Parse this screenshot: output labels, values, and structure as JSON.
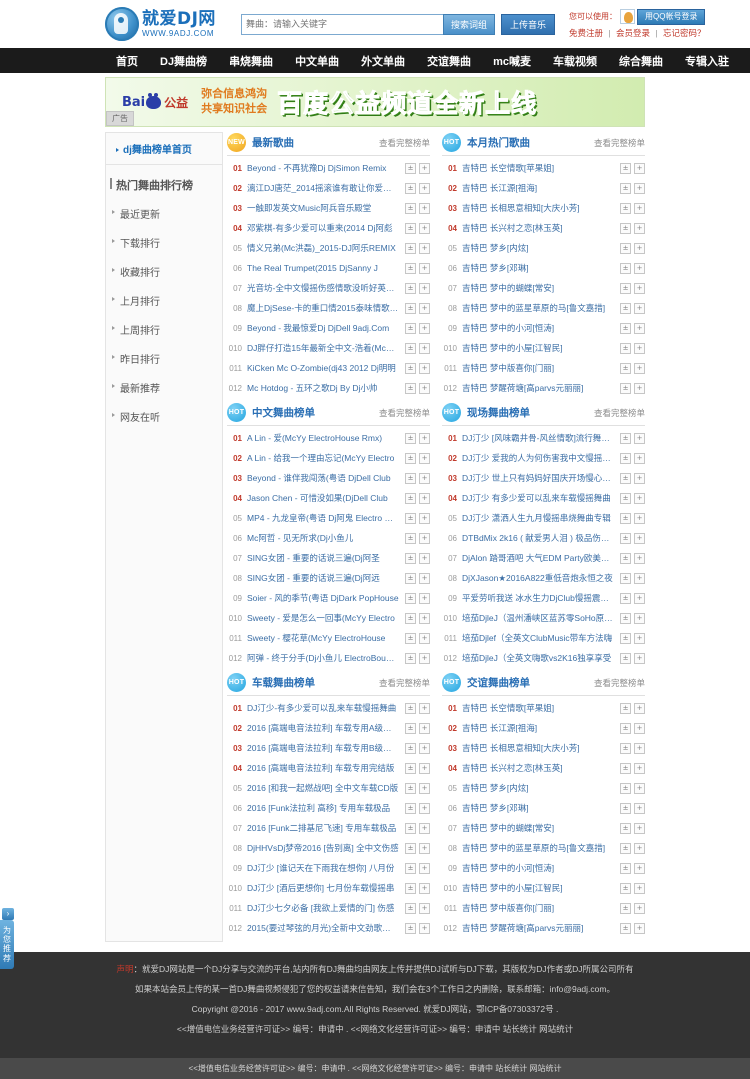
{
  "site": {
    "logo_name": "就爱DJ网",
    "logo_url": "WWW.9ADJ.COM"
  },
  "search": {
    "placeholder": "舞曲：请输入关键字",
    "value": "",
    "search_label": "搜索词组",
    "upload_label": "上传音乐"
  },
  "user": {
    "hint": "您可以使用：",
    "qq_login_label": "用QQ帐号登录",
    "register": "免费注册",
    "login": "会员登录",
    "forgot": "忘记密码？",
    "sep": "|"
  },
  "nav": [
    {
      "label": "首页"
    },
    {
      "label": "DJ舞曲榜"
    },
    {
      "label": "串烧舞曲"
    },
    {
      "label": "中文单曲"
    },
    {
      "label": "外文单曲"
    },
    {
      "label": "交谊舞曲"
    },
    {
      "label": "mc喊麦"
    },
    {
      "label": "车载视频"
    },
    {
      "label": "综合舞曲"
    },
    {
      "label": "专辑入驻"
    }
  ],
  "banner": {
    "brand_bai": "Bai",
    "brand_gongyi": "公益",
    "slogan_line1": "弥合信息鸿沟",
    "slogan_line2": "共享知识社会",
    "headline": "百度公益频道全新上线",
    "ad_tag": "广告"
  },
  "sidebar": {
    "home_label": "dj舞曲榜单首页",
    "section_title": "热门舞曲排行榜",
    "items": [
      {
        "label": "最近更新"
      },
      {
        "label": "下载排行"
      },
      {
        "label": "收藏排行"
      },
      {
        "label": "上月排行"
      },
      {
        "label": "上周排行"
      },
      {
        "label": "昨日排行"
      },
      {
        "label": "最新推荐"
      },
      {
        "label": "网友在听"
      }
    ]
  },
  "common": {
    "more_label": "查看完整榜单",
    "download_icon": "±",
    "add_icon": "+"
  },
  "panels": [
    {
      "badge": "NEW",
      "badge_type": "new",
      "title": "最新歌曲",
      "songs": [
        {
          "num": "01",
          "name": "Beyond - 不再犹豫Dj DjSimon Remix"
        },
        {
          "num": "02",
          "name": "漓江DJ唐茫_2014摇滚谁有敢让你爱不经手"
        },
        {
          "num": "03",
          "name": "一触即发英文Music阿兵音乐殿堂"
        },
        {
          "num": "04",
          "name": "邓紫棋-有多少爱可以重来(2014 Dj阿彪"
        },
        {
          "num": "05",
          "name": "情义兄弟(Mc洪磊)_2015-DJ阿乐REMIX"
        },
        {
          "num": "06",
          "name": "The Real Trumpet(2015 DjSanny J"
        },
        {
          "num": "07",
          "name": "光音坊-全中文慢摇伤感情歌没听好英电音"
        },
        {
          "num": "08",
          "name": "魔上DjSese-卡的重口情2015泰味情歌一路"
        },
        {
          "num": "09",
          "name": "Beyond - 我最惊爱Dj DjDell 9adj.Com"
        },
        {
          "num": "010",
          "name": "DJ胖仔打造15年最新全中文-浩着(Mc洪磊)"
        },
        {
          "num": "011",
          "name": "KiCken Mc O-Zombie(dj43 2012 Dj明明"
        },
        {
          "num": "012",
          "name": "Mc Hotdog - 五环之歌Dj By Dj小帅"
        }
      ]
    },
    {
      "badge": "HOT",
      "badge_type": "hot",
      "title": "本月热门歌曲",
      "songs": [
        {
          "num": "01",
          "name": "吉特巴 长空情歌[苹果姐]"
        },
        {
          "num": "02",
          "name": "吉特巴 长江源[祖海]"
        },
        {
          "num": "03",
          "name": "吉特巴 长相思意相知[大庆小芳]"
        },
        {
          "num": "04",
          "name": "吉特巴 长兴村之恋[林玉英]"
        },
        {
          "num": "05",
          "name": "吉特巴 梦乡[内炫]"
        },
        {
          "num": "06",
          "name": "吉特巴 梦乡[邓琳]"
        },
        {
          "num": "07",
          "name": "吉特巴 梦中的蝴蝶[常安]"
        },
        {
          "num": "08",
          "name": "吉特巴 梦中的蓝星草原的马[鲁文嘉措]"
        },
        {
          "num": "09",
          "name": "吉特巴 梦中的小河[恒涛]"
        },
        {
          "num": "010",
          "name": "吉特巴 梦中的小屋[江智民]"
        },
        {
          "num": "011",
          "name": "吉特巴 梦中版喜你[门丽]"
        },
        {
          "num": "012",
          "name": "吉特巴 梦醒荷塘[高parvs元丽丽]"
        }
      ]
    },
    {
      "badge": "HOT",
      "badge_type": "hot",
      "title": "中文舞曲榜单",
      "songs": [
        {
          "num": "01",
          "name": "A Lin - 爱(McYy ElectroHouse Rmx)"
        },
        {
          "num": "02",
          "name": "A Lin - 给我一个理由忘记(McYy Electro"
        },
        {
          "num": "03",
          "name": "Beyond - 谁伴我闯荡(粤语 DjDell Club"
        },
        {
          "num": "04",
          "name": "Jason Chen - 可惜没如果(DjDell Club"
        },
        {
          "num": "05",
          "name": "MP4 - 九龙皇帝(粤语 Dj阿鬼 Electro Rmx)"
        },
        {
          "num": "06",
          "name": "Mc阿哲 - 见无所求(Dj小鱼儿"
        },
        {
          "num": "07",
          "name": "SING女团 - 重要的话说三遍(Dj阿圣"
        },
        {
          "num": "08",
          "name": "SING女团 - 重要的话说三遍(Dj阿远"
        },
        {
          "num": "09",
          "name": "Soier - 风的季节(粤语 DjDark PopHouse"
        },
        {
          "num": "010",
          "name": "Sweety - 爱是怎么一回事(McYy Electro"
        },
        {
          "num": "011",
          "name": "Sweety - 樱花草(McYy ElectroHouse"
        },
        {
          "num": "012",
          "name": "阿弹 - 终于分手(Dj小鱼儿 ElectroBounce"
        }
      ]
    },
    {
      "badge": "HOT",
      "badge_type": "hot",
      "title": "现场舞曲榜单",
      "songs": [
        {
          "num": "01",
          "name": "DJ汀少 [风味霸井骨-风丝情歌]流行舞曲慢"
        },
        {
          "num": "02",
          "name": "DJ汀少 爱我的人为何伤害我中文慢摇串烧"
        },
        {
          "num": "03",
          "name": "DJ汀少 世上只有妈妈好国庆开场慢心串烧"
        },
        {
          "num": "04",
          "name": "DJ汀少 有多少爱可以乱来车载慢摇舞曲"
        },
        {
          "num": "05",
          "name": "DJ汀少 潇洒人生九月慢摇串烧舞曲专辑"
        },
        {
          "num": "06",
          "name": "DTBdMix 2k16 ( 献爱男人泪 ) 极品伤感连"
        },
        {
          "num": "07",
          "name": "DjAlon 踏哥酒吧 大气EDM Party欧美电音"
        },
        {
          "num": "08",
          "name": "DjXJason★2016A822重低音炮永恒之夜"
        },
        {
          "num": "09",
          "name": "平爱劳听我送 冰水生力DjClub慢摇震撼大"
        },
        {
          "num": "010",
          "name": "培茄DjleJ（温州潘峡区蓝苏零SoHo原创打造"
        },
        {
          "num": "011",
          "name": "培茄Djlef（全英文ClubMusic带车方法嗨"
        },
        {
          "num": "012",
          "name": "培茄DjleJ（全英文嗨歌vs2K16独享享受"
        }
      ]
    },
    {
      "badge": "HOT",
      "badge_type": "hot",
      "title": "车载舞曲榜单",
      "songs": [
        {
          "num": "01",
          "name": "DJ汀少-有多少爱可以乱来车载慢摇舞曲"
        },
        {
          "num": "02",
          "name": "2016 [高端电音法拉利] 车载专用A级极品"
        },
        {
          "num": "03",
          "name": "2016 [高端电音法拉利] 车载专用B级极品"
        },
        {
          "num": "04",
          "name": "2016 [高端电音法拉利] 车载专用完结版"
        },
        {
          "num": "05",
          "name": "2016 [和我一起燃战吧] 全中文车载CD版"
        },
        {
          "num": "06",
          "name": "2016 [Funk法拉利 高移] 专用车载极品"
        },
        {
          "num": "07",
          "name": "2016 [Funk二排基尼飞速] 专用车载极品"
        },
        {
          "num": "08",
          "name": "DjHHVsDj梦帝2016 [告别离] 全中文伤感"
        },
        {
          "num": "09",
          "name": "DJ汀少 [谁记天在下雨我在想你] 八月份"
        },
        {
          "num": "010",
          "name": "DJ汀少 [酒后更想你] 七月份车载慢摇串"
        },
        {
          "num": "011",
          "name": "DJ汀少七夕必备 [我欲上爱情的门] 伤感"
        },
        {
          "num": "012",
          "name": "2015(要过琴弦的月光)全新中文劲歌慢车载"
        }
      ]
    },
    {
      "badge": "HOT",
      "badge_type": "hot",
      "title": "交谊舞曲榜单",
      "songs": [
        {
          "num": "01",
          "name": "吉特巴 长空情歌[苹果姐]"
        },
        {
          "num": "02",
          "name": "吉特巴 长江源[祖海]"
        },
        {
          "num": "03",
          "name": "吉特巴 长相思意相知[大庆小芳]"
        },
        {
          "num": "04",
          "name": "吉特巴 长兴村之恋[林玉英]"
        },
        {
          "num": "05",
          "name": "吉特巴 梦乡[内炫]"
        },
        {
          "num": "06",
          "name": "吉特巴 梦乡[邓琳]"
        },
        {
          "num": "07",
          "name": "吉特巴 梦中的蝴蝶[常安]"
        },
        {
          "num": "08",
          "name": "吉特巴 梦中的蓝星草原的马[鲁文嘉措]"
        },
        {
          "num": "09",
          "name": "吉特巴 梦中的小河[恒涛]"
        },
        {
          "num": "010",
          "name": "吉特巴 梦中的小屋[江智民]"
        },
        {
          "num": "011",
          "name": "吉特巴 梦中版喜你[门丽]"
        },
        {
          "num": "012",
          "name": "吉特巴 梦醒荷塘[高parvs元丽丽]"
        }
      ]
    }
  ],
  "footer": {
    "line1_label": "声明",
    "line1": "：就爱DJ网站是一个DJ分享与交流的平台,站内所有DJ舞曲均由网友上传并提供DJ试听与DJ下载，其版权为DJ作者或DJ所属公司所有",
    "line2": "如果本站会员上传的某一首DJ舞曲视频侵犯了您的权益请来信告知，我们会在3个工作日之内删除，联系邮箱：info@9adj.com。",
    "line3": "Copyright @2016 - 2017 www.9adj.com.All Rights Reserved. 就爱DJ网站，鄂ICP备07303372号 .",
    "line4": "<<增值电信业务经营许可证>> 编号：申请中 . <<网络文化经营许可证>> 编号：申请中 站长统计 网站统计",
    "bottom": "<<增值电信业务经营许可证>> 编号：申请中 . <<网络文化经营许可证>> 编号：申请中 站长统计 网站统计"
  },
  "float": {
    "arrow": "›",
    "label": "为您推荐"
  }
}
